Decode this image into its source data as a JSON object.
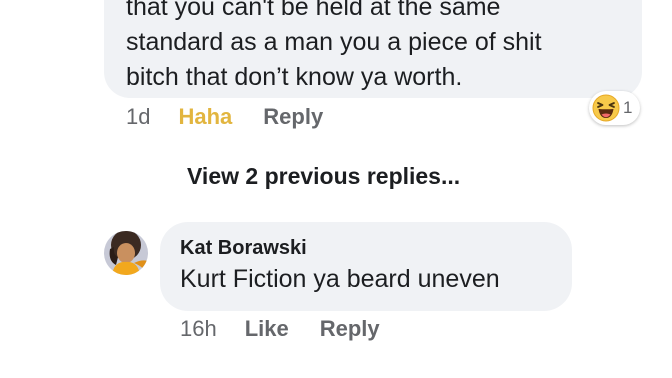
{
  "top_comment": {
    "lines": [
      "that you can't be held at the same",
      "standard as a man you a piece of shit",
      "bitch that don’t know ya worth."
    ],
    "time": "1d",
    "reaction_label": "Haha",
    "reply_label": "Reply",
    "reaction_icon": "haha-emoji-icon",
    "reaction_count": "1"
  },
  "view_previous": "View 2 previous replies...",
  "reply_comment": {
    "author": "Kat Borawski",
    "text": "Kurt Fiction ya beard uneven",
    "time": "16h",
    "like_label": "Like",
    "reply_label": "Reply"
  },
  "colors": {
    "bubble": "#f0f2f5",
    "text": "#1c1e21",
    "muted": "#65676b",
    "haha_accent": "#e2b53f"
  }
}
